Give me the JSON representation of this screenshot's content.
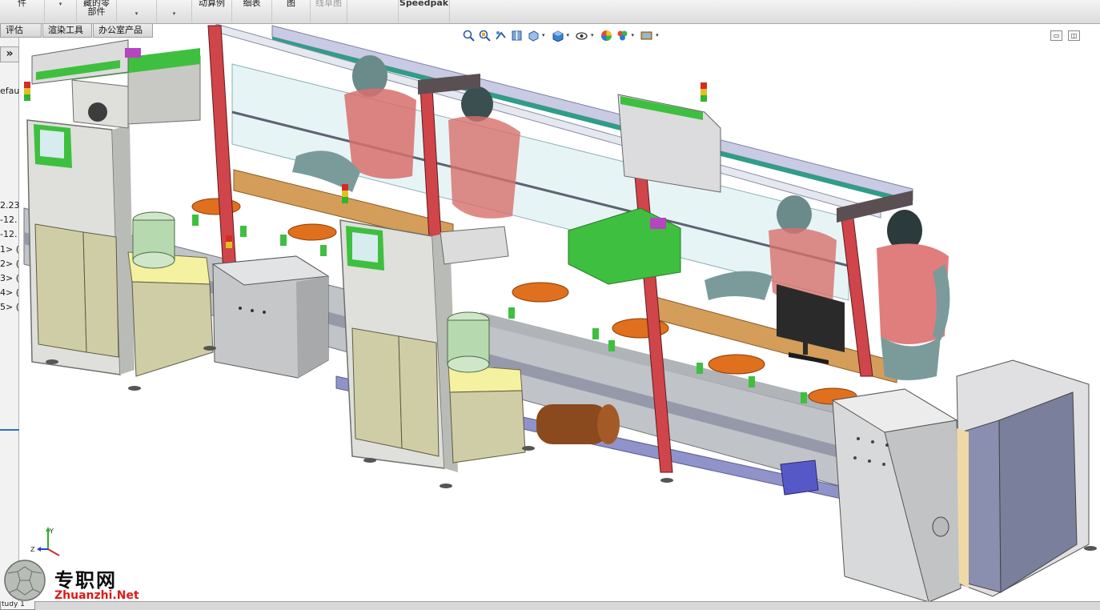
{
  "ribbon": {
    "items": [
      {
        "line1": "件",
        "line2": ""
      },
      {
        "line1": "",
        "line2": ""
      },
      {
        "line1": "藏的零",
        "line2": "部件"
      },
      {
        "line1": "",
        "line2": ""
      },
      {
        "line1": "",
        "line2": ""
      },
      {
        "line1": "动算例",
        "line2": ""
      },
      {
        "line1": "细表",
        "line2": ""
      },
      {
        "line1": "图",
        "line2": ""
      },
      {
        "line1": "线草图",
        "line2": ""
      },
      {
        "line1": "Speedpak",
        "line2": ""
      }
    ]
  },
  "tabs": [
    "评估",
    "渲染工具",
    "办公室产品"
  ],
  "left_panel": {
    "expand_label": "»",
    "lines": [
      "efau",
      "2.23",
      "-12.",
      "-12.",
      "1> (",
      "2> (",
      "3> (",
      "4> (",
      "5> ("
    ]
  },
  "heads_up_icons": [
    "zoom-to-fit-icon",
    "zoom-to-area-icon",
    "previous-view-icon",
    "section-view-icon",
    "view-orientation-icon",
    "display-style-icon",
    "hide-show-items-icon",
    "edit-appearance-icon",
    "apply-scene-icon",
    "view-settings-icon"
  ],
  "window_controls": [
    "restore",
    "maximize"
  ],
  "triad": {
    "x_label": "",
    "y_label": "Y",
    "z_label": "Z"
  },
  "watermark": {
    "chinese": "专职网",
    "english": "Zhuanzhi.Net"
  },
  "bottom_tab": {
    "label": "tudy 1"
  },
  "colors": {
    "frame_grey": "#b9bdc4",
    "panel_green": "#3fbf3f",
    "orange_fixture": "#e0701e",
    "wood_table": "#d49d5a",
    "mannequin": "#c97470",
    "red_post": "#d0454a",
    "cabinet_beige": "#cfcda6",
    "yellow_base": "#f4f1a0",
    "guard_glass": "#c9e6ea",
    "brand_red": "#e01818"
  }
}
